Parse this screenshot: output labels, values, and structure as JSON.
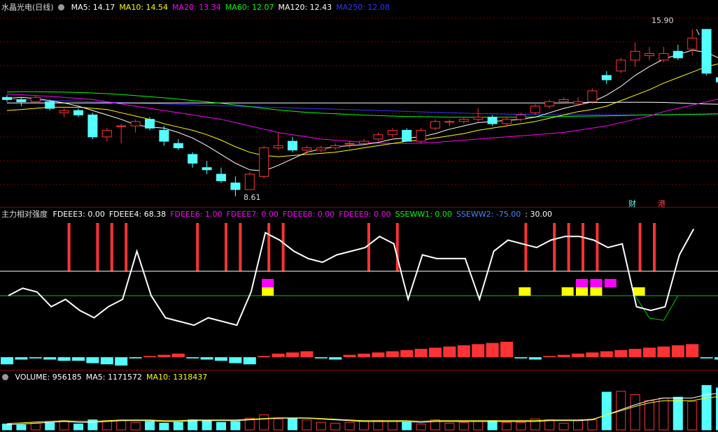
{
  "price_pane": {
    "title": "水晶光电(日线)",
    "ma": [
      {
        "label": "MA5: 14.17",
        "color": "#ffffff"
      },
      {
        "label": "MA10: 14.54",
        "color": "#ffff00"
      },
      {
        "label": "MA20: 13.34",
        "color": "#ff00ff"
      },
      {
        "label": "MA60: 12.07",
        "color": "#00ff00"
      },
      {
        "label": "MA120: 12.43",
        "color": "#ffffff"
      },
      {
        "label": "MA250: 12.08",
        "color": "#3333ff"
      }
    ],
    "high_label": "15.90",
    "low_label": "8.61",
    "tag_cai": "财",
    "tag_gang": "港"
  },
  "indicator_pane": {
    "title": "主力相对强度",
    "items": [
      {
        "label": "FDEEE3: 0.00",
        "color": "#ffffff"
      },
      {
        "label": "FDEEE4: 68.38",
        "color": "#ffffff"
      },
      {
        "label": "FDEEE6: 1.00",
        "color": "#ff00ff"
      },
      {
        "label": "FDEEE7: 0.00",
        "color": "#ff00ff"
      },
      {
        "label": "FDEEE8: 0.00",
        "color": "#ff00ff"
      },
      {
        "label": "FDEEE9: 0.00",
        "color": "#ff00ff"
      },
      {
        "label": "SSEWW1: 0.00",
        "color": "#00ff00"
      },
      {
        "label": "SSEWW2: -75.00",
        "color": "#4488ff"
      },
      {
        "label": ": 30.00",
        "color": "#ffffff"
      }
    ]
  },
  "volume_pane": {
    "items": [
      {
        "label": "VOLUME: 956185",
        "color": "#ffffff"
      },
      {
        "label": "MA5: 1171572",
        "color": "#ffffff"
      },
      {
        "label": "MA10: 1318437",
        "color": "#ffff00"
      }
    ]
  },
  "colors": {
    "up": "#ff3333",
    "down": "#54ffff",
    "background": "#000000"
  },
  "chart_data": {
    "type": "candlestick",
    "ylim": [
      8.0,
      16.6
    ],
    "candles": [
      [
        12.8,
        12.9,
        12.6,
        12.7
      ],
      [
        12.7,
        12.8,
        12.4,
        12.6
      ],
      [
        12.6,
        12.9,
        12.5,
        12.8
      ],
      [
        12.6,
        12.7,
        12.2,
        12.3
      ],
      [
        12.1,
        12.3,
        11.9,
        12.2
      ],
      [
        12.2,
        12.3,
        11.9,
        12.0
      ],
      [
        12.0,
        12.1,
        10.9,
        11.0
      ],
      [
        11.0,
        11.4,
        10.8,
        11.3
      ],
      [
        11.5,
        11.6,
        10.7,
        11.5
      ],
      [
        11.5,
        11.8,
        11.2,
        11.7
      ],
      [
        11.8,
        11.9,
        11.3,
        11.4
      ],
      [
        11.3,
        11.5,
        10.6,
        10.8
      ],
      [
        10.7,
        10.9,
        10.4,
        10.5
      ],
      [
        10.2,
        10.3,
        9.6,
        9.8
      ],
      [
        9.6,
        9.9,
        9.3,
        9.5
      ],
      [
        9.3,
        9.6,
        8.9,
        9.0
      ],
      [
        8.9,
        9.2,
        8.61,
        8.6
      ],
      [
        8.6,
        9.4,
        8.6,
        9.3
      ],
      [
        9.2,
        10.6,
        9.1,
        10.5
      ],
      [
        10.5,
        11.2,
        10.4,
        10.6
      ],
      [
        10.8,
        11.0,
        10.3,
        10.4
      ],
      [
        10.4,
        10.6,
        10.2,
        10.5
      ],
      [
        10.4,
        10.6,
        10.3,
        10.5
      ],
      [
        10.5,
        10.7,
        10.4,
        10.6
      ],
      [
        10.7,
        10.8,
        10.5,
        10.7
      ],
      [
        10.7,
        10.9,
        10.6,
        10.8
      ],
      [
        10.9,
        11.2,
        10.8,
        11.1
      ],
      [
        11.1,
        11.4,
        11.0,
        11.3
      ],
      [
        11.3,
        11.4,
        10.8,
        10.8
      ],
      [
        10.8,
        11.4,
        10.7,
        11.3
      ],
      [
        11.4,
        11.8,
        11.3,
        11.7
      ],
      [
        11.7,
        11.8,
        11.5,
        11.7
      ],
      [
        11.7,
        11.9,
        11.6,
        11.8
      ],
      [
        11.8,
        12.3,
        11.7,
        11.9
      ],
      [
        11.9,
        12.0,
        11.5,
        11.6
      ],
      [
        11.6,
        11.9,
        11.5,
        11.8
      ],
      [
        11.8,
        12.1,
        11.7,
        12.0
      ],
      [
        12.1,
        12.5,
        12.0,
        12.4
      ],
      [
        12.4,
        12.7,
        12.3,
        12.6
      ],
      [
        12.6,
        12.8,
        12.5,
        12.7
      ],
      [
        12.5,
        12.8,
        12.4,
        12.6
      ],
      [
        12.6,
        13.2,
        12.5,
        13.1
      ],
      [
        13.8,
        14.0,
        13.4,
        13.6
      ],
      [
        14.0,
        14.6,
        13.9,
        14.5
      ],
      [
        14.5,
        15.3,
        14.2,
        14.9
      ],
      [
        14.7,
        15.1,
        14.5,
        14.8
      ],
      [
        14.5,
        15.1,
        14.4,
        14.8
      ],
      [
        14.9,
        15.2,
        14.5,
        14.6
      ],
      [
        15.0,
        15.9,
        14.7,
        15.5
      ],
      [
        15.9,
        15.9,
        13.8,
        13.9
      ],
      [
        13.7,
        13.9,
        13.3,
        13.5
      ],
      [
        13.5,
        13.8,
        13.4,
        13.5
      ],
      [
        13.6,
        14.1,
        13.5,
        14.0
      ],
      [
        14.0,
        15.1,
        13.8,
        14.9
      ]
    ],
    "ma5": [
      12.75,
      12.8,
      12.75,
      12.65,
      12.55,
      12.4,
      12.2,
      12.0,
      11.8,
      11.55,
      11.45,
      11.4,
      11.2,
      10.95,
      10.6,
      10.2,
      9.8,
      9.5,
      9.45,
      9.7,
      10.0,
      10.3,
      10.45,
      10.55,
      10.6,
      10.65,
      10.75,
      10.9,
      10.95,
      11.0,
      11.15,
      11.35,
      11.5,
      11.65,
      11.7,
      11.75,
      11.8,
      11.9,
      12.1,
      12.3,
      12.45,
      12.6,
      12.9,
      13.3,
      13.8,
      14.2,
      14.55,
      14.75,
      14.95,
      14.85,
      14.55,
      14.25,
      13.95,
      14.2
    ],
    "ma10": [
      12.2,
      12.25,
      12.3,
      12.35,
      12.35,
      12.35,
      12.3,
      12.25,
      12.1,
      11.95,
      11.8,
      11.6,
      11.45,
      11.3,
      11.1,
      10.85,
      10.55,
      10.3,
      10.15,
      10.1,
      10.15,
      10.2,
      10.25,
      10.3,
      10.4,
      10.5,
      10.6,
      10.7,
      10.8,
      10.85,
      10.95,
      11.05,
      11.15,
      11.3,
      11.4,
      11.5,
      11.6,
      11.7,
      11.85,
      12.0,
      12.15,
      12.25,
      12.4,
      12.65,
      12.9,
      13.15,
      13.45,
      13.7,
      13.95,
      14.2,
      14.35,
      14.45,
      14.5,
      14.54
    ],
    "ma20": [
      12.95,
      12.92,
      12.88,
      12.85,
      12.8,
      12.75,
      12.7,
      12.6,
      12.5,
      12.4,
      12.3,
      12.2,
      12.1,
      12.0,
      11.9,
      11.8,
      11.65,
      11.5,
      11.35,
      11.2,
      11.1,
      11.0,
      10.9,
      10.85,
      10.8,
      10.75,
      10.72,
      10.7,
      10.7,
      10.72,
      10.75,
      10.8,
      10.85,
      10.9,
      10.95,
      11.0,
      11.05,
      11.1,
      11.15,
      11.2,
      11.3,
      11.4,
      11.5,
      11.65,
      11.8,
      11.95,
      12.15,
      12.3,
      12.45,
      12.6,
      12.75,
      12.9,
      13.1,
      13.34
    ],
    "ma60": [
      13.05,
      13.06,
      13.06,
      13.05,
      13.04,
      13.02,
      13.0,
      12.97,
      12.93,
      12.88,
      12.83,
      12.78,
      12.72,
      12.66,
      12.6,
      12.53,
      12.45,
      12.38,
      12.3,
      12.23,
      12.17,
      12.12,
      12.08,
      12.05,
      12.02,
      11.99,
      11.97,
      11.95,
      11.93,
      11.92,
      11.91,
      11.9,
      11.9,
      11.9,
      11.9,
      11.9,
      11.9,
      11.91,
      11.92,
      11.93,
      11.94,
      11.95,
      11.96,
      11.97,
      11.99,
      12.0,
      12.01,
      12.02,
      12.03,
      12.04,
      12.05,
      12.05,
      12.06,
      12.07
    ],
    "ma120": [
      12.55,
      12.55,
      12.55,
      12.55,
      12.55,
      12.55,
      12.55,
      12.55,
      12.55,
      12.55,
      12.55,
      12.55,
      12.55,
      12.55,
      12.55,
      12.55,
      12.55,
      12.55,
      12.55,
      12.55,
      12.55,
      12.55,
      12.55,
      12.55,
      12.55,
      12.55,
      12.55,
      12.55,
      12.55,
      12.55,
      12.55,
      12.55,
      12.55,
      12.55,
      12.55,
      12.55,
      12.55,
      12.55,
      12.55,
      12.55,
      12.56,
      12.57,
      12.57,
      12.58,
      12.58,
      12.58,
      12.57,
      12.55,
      12.52,
      12.5,
      12.48,
      12.46,
      12.44,
      12.43
    ],
    "ma250": [
      12.7,
      12.69,
      12.68,
      12.66,
      12.64,
      12.62,
      12.6,
      12.58,
      12.56,
      12.54,
      12.52,
      12.5,
      12.48,
      12.46,
      12.44,
      12.42,
      12.4,
      12.38,
      12.36,
      12.34,
      12.32,
      12.3,
      12.28,
      12.26,
      12.24,
      12.22,
      12.2,
      12.18,
      12.16,
      12.14,
      12.12,
      12.1,
      12.08,
      12.06,
      12.05,
      12.04,
      12.03,
      12.02,
      12.01,
      12.0,
      12.0,
      12.0,
      12.0,
      12.0,
      12.0,
      12.0,
      12.0,
      12.01,
      12.02,
      12.03,
      12.04,
      12.05,
      12.06,
      12.08
    ],
    "strength_ylim": [
      -60,
      110
    ],
    "strength_line": [
      10,
      20,
      15,
      -5,
      5,
      -10,
      -20,
      -5,
      5,
      70,
      10,
      -20,
      -25,
      -30,
      -20,
      -25,
      -30,
      15,
      95,
      85,
      70,
      60,
      55,
      65,
      70,
      75,
      90,
      80,
      5,
      65,
      60,
      60,
      60,
      5,
      70,
      85,
      80,
      75,
      85,
      90,
      90,
      85,
      75,
      80,
      -5,
      -10,
      -5,
      65,
      100
    ],
    "red_sticks": [
      4,
      6,
      7,
      8,
      13,
      15,
      16,
      18,
      19,
      25,
      27,
      36,
      38,
      39,
      40,
      41,
      44,
      45
    ],
    "magenta_blocks": [
      18,
      40,
      41,
      42
    ],
    "yellow_blocks": [
      18,
      36,
      39,
      40,
      41,
      44
    ],
    "green_line_x": [
      44,
      45,
      46,
      47,
      48
    ],
    "green_line_y": [
      30,
      10,
      8,
      30,
      30
    ],
    "histogram": [
      -6,
      -2,
      -1,
      -2,
      -3,
      -3,
      -5,
      -6,
      -7,
      -1,
      1,
      2,
      3,
      -1,
      -2,
      -3,
      -5,
      -6,
      1,
      3,
      4,
      5,
      -1,
      -2,
      2,
      3,
      4,
      5,
      6,
      7,
      8,
      9,
      10,
      11,
      12,
      13,
      -1,
      -2,
      1,
      2,
      3,
      4,
      5,
      6,
      7,
      8,
      9,
      10,
      11,
      -1,
      -2,
      -3,
      -4,
      1
    ],
    "volume": [
      7,
      6,
      8,
      9,
      10,
      7,
      12,
      11,
      11,
      9,
      10,
      8,
      9,
      12,
      11,
      9,
      10,
      14,
      18,
      13,
      14,
      12,
      9,
      8,
      9,
      10,
      11,
      10,
      9,
      7,
      12,
      8,
      9,
      10,
      11,
      9,
      9,
      13,
      12,
      8,
      11,
      12,
      45,
      46,
      42,
      35,
      38,
      39,
      34,
      53,
      50,
      40,
      41,
      39
    ],
    "vol_ma": [
      6,
      7,
      8,
      9,
      10,
      9,
      9,
      10,
      11,
      11,
      11,
      10,
      10,
      11,
      11,
      11,
      11,
      12,
      13,
      14,
      14,
      14,
      13,
      12,
      11,
      10,
      10,
      10,
      10,
      9,
      10,
      10,
      10,
      10,
      10,
      10,
      10,
      10,
      11,
      11,
      11,
      12,
      18,
      24,
      30,
      35,
      38,
      38,
      38,
      42,
      44,
      43,
      42,
      41
    ]
  }
}
